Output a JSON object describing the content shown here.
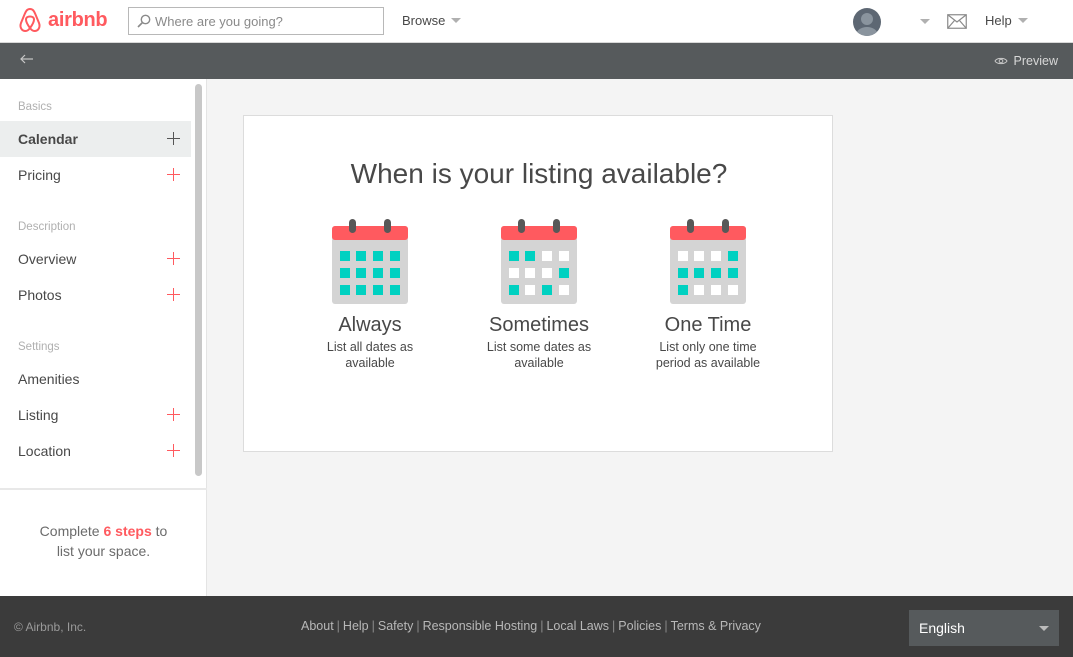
{
  "brand": {
    "name": "airbnb",
    "color": "#ff5a5f"
  },
  "header": {
    "search_placeholder": "Where are you going?",
    "browse_label": "Browse",
    "help_label": "Help"
  },
  "subbar": {
    "preview_label": "Preview",
    "back_icon": "arrow-left-icon"
  },
  "sidebar": {
    "sections": [
      {
        "label": "Basics",
        "items": [
          {
            "label": "Calendar",
            "active": true
          },
          {
            "label": "Pricing"
          }
        ]
      },
      {
        "label": "Description",
        "items": [
          {
            "label": "Overview"
          },
          {
            "label": "Photos"
          }
        ]
      },
      {
        "label": "Settings",
        "items": [
          {
            "label": "Amenities"
          },
          {
            "label": "Listing"
          },
          {
            "label": "Location"
          }
        ]
      }
    ],
    "steps": {
      "prefix": "Complete ",
      "highlight": "6 steps",
      "suffix": " to",
      "line2": "list your space."
    }
  },
  "main": {
    "title": "When is your listing available?",
    "options": [
      {
        "title": "Always",
        "description": "List all dates as available"
      },
      {
        "title": "Sometimes",
        "description": "List some dates as available"
      },
      {
        "title": "One Time",
        "description": "List only one time period as available"
      }
    ]
  },
  "footer": {
    "copyright": "© Airbnb, Inc.",
    "links": [
      "About",
      "Help",
      "Safety",
      "Responsible Hosting",
      "Local Laws",
      "Policies",
      "Terms & Privacy"
    ],
    "language": "English"
  }
}
